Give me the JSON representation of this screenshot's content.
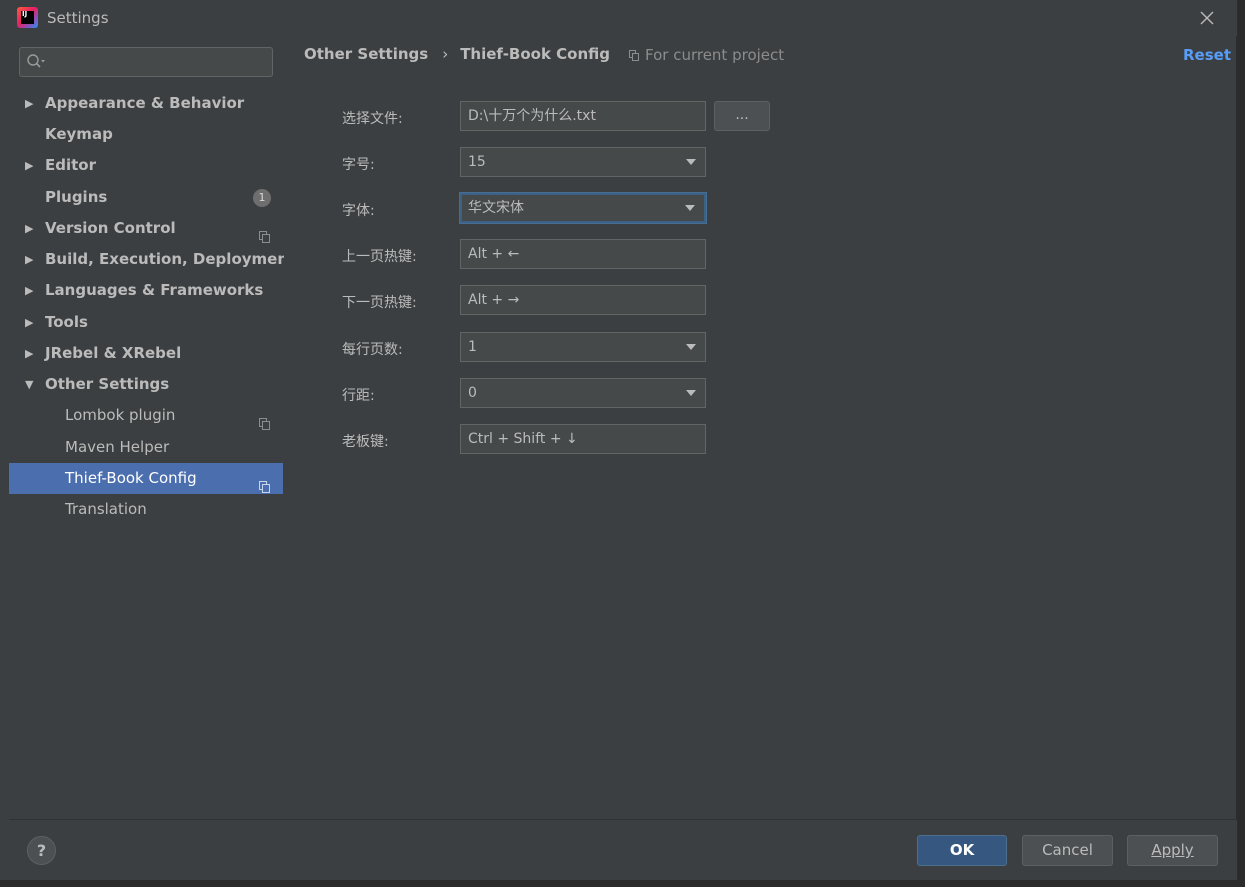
{
  "window": {
    "title": "Settings"
  },
  "search": {
    "placeholder": "",
    "value": ""
  },
  "sidebar": {
    "items": [
      {
        "label": "Appearance & Behavior",
        "expandable": true,
        "expanded": false,
        "bold": true,
        "level": 0
      },
      {
        "label": "Keymap",
        "expandable": false,
        "bold": true,
        "level": 0
      },
      {
        "label": "Editor",
        "expandable": true,
        "expanded": false,
        "bold": true,
        "level": 0
      },
      {
        "label": "Plugins",
        "expandable": false,
        "bold": true,
        "level": 0,
        "badge": "1"
      },
      {
        "label": "Version Control",
        "expandable": true,
        "expanded": false,
        "bold": true,
        "level": 0,
        "project_icon": true
      },
      {
        "label": "Build, Execution, Deployment",
        "expandable": true,
        "expanded": false,
        "bold": true,
        "level": 0
      },
      {
        "label": "Languages & Frameworks",
        "expandable": true,
        "expanded": false,
        "bold": true,
        "level": 0
      },
      {
        "label": "Tools",
        "expandable": true,
        "expanded": false,
        "bold": true,
        "level": 0
      },
      {
        "label": "JRebel & XRebel",
        "expandable": true,
        "expanded": false,
        "bold": true,
        "level": 0
      },
      {
        "label": "Other Settings",
        "expandable": true,
        "expanded": true,
        "bold": true,
        "level": 0
      },
      {
        "label": "Lombok plugin",
        "expandable": false,
        "bold": false,
        "level": 1,
        "project_icon": true
      },
      {
        "label": "Maven Helper",
        "expandable": false,
        "bold": false,
        "level": 1
      },
      {
        "label": "Thief-Book Config",
        "expandable": false,
        "bold": false,
        "level": 1,
        "project_icon": true,
        "selected": true
      },
      {
        "label": "Translation",
        "expandable": false,
        "bold": false,
        "level": 1
      }
    ]
  },
  "header": {
    "breadcrumb_parent": "Other Settings",
    "breadcrumb_separator": "›",
    "breadcrumb_current": "Thief-Book Config",
    "scope_label": "For current project",
    "reset_label": "Reset"
  },
  "form": {
    "file": {
      "label": "选择文件:",
      "value": "D:\\十万个为什么.txt",
      "browse_label": "..."
    },
    "font_size": {
      "label": "字号:",
      "value": "15"
    },
    "font": {
      "label": "字体:",
      "value": "华文宋体"
    },
    "prev_page_hotkey": {
      "label": "上一页热键:",
      "value": "Alt + ←"
    },
    "next_page_hotkey": {
      "label": "下一页热键:",
      "value": "Alt + →"
    },
    "pages_per_line": {
      "label": "每行页数:",
      "value": "1"
    },
    "line_spacing": {
      "label": "行距:",
      "value": "0"
    },
    "boss_key": {
      "label": "老板键:",
      "value": "Ctrl + Shift + ↓"
    }
  },
  "footer": {
    "help_label": "?",
    "ok_label": "OK",
    "cancel_label": "Cancel",
    "apply_label": "Apply"
  },
  "colors": {
    "background": "#3c3f41",
    "selection": "#4b6eaf",
    "link": "#589df6",
    "primary_button": "#365880",
    "field_background": "#45494a"
  }
}
